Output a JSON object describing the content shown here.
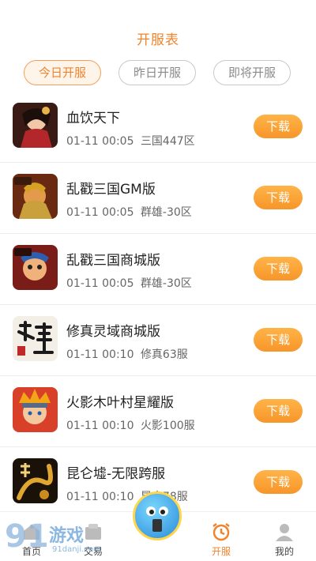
{
  "header": {
    "title": "开服表"
  },
  "tabs": [
    {
      "label": "今日开服",
      "active": true
    },
    {
      "label": "昨日开服",
      "active": false
    },
    {
      "label": "即将开服",
      "active": false
    }
  ],
  "games": [
    {
      "name": "血饮天下",
      "time": "01-11 00:05",
      "server": "三国447区",
      "button": "下载",
      "icon": "warrior-portrait-icon"
    },
    {
      "name": "乱戳三国GM版",
      "time": "01-11 00:05",
      "server": "群雄-30区",
      "button": "下载",
      "icon": "armored-general-icon"
    },
    {
      "name": "乱戳三国商城版",
      "time": "01-11 00:05",
      "server": "群雄-30区",
      "button": "下载",
      "icon": "cartoon-hero-icon"
    },
    {
      "name": "修真灵域商城版",
      "time": "01-11 00:10",
      "server": "修真63服",
      "button": "下载",
      "icon": "calligraphy-icon"
    },
    {
      "name": "火影木叶村星耀版",
      "time": "01-11 00:10",
      "server": "火影100服",
      "button": "下载",
      "icon": "ninja-icon"
    },
    {
      "name": "昆仑墟-无限跨服",
      "time": "01-11 00:10",
      "server": "昆仑78服",
      "button": "下载",
      "icon": "dragon-gold-icon"
    }
  ],
  "bottom_nav": {
    "items": [
      {
        "label": "首页",
        "icon": "home-icon"
      },
      {
        "label": "交易",
        "icon": "shop-icon"
      },
      {
        "label": "开服",
        "icon": "alarm-clock-icon",
        "active": true
      },
      {
        "label": "我的",
        "icon": "user-icon"
      }
    ]
  },
  "watermark": {
    "logo": "91",
    "text": "游戏",
    "sub": "91danji.com"
  },
  "colors": {
    "accent": "#f0832d",
    "button": "#f7962a"
  }
}
